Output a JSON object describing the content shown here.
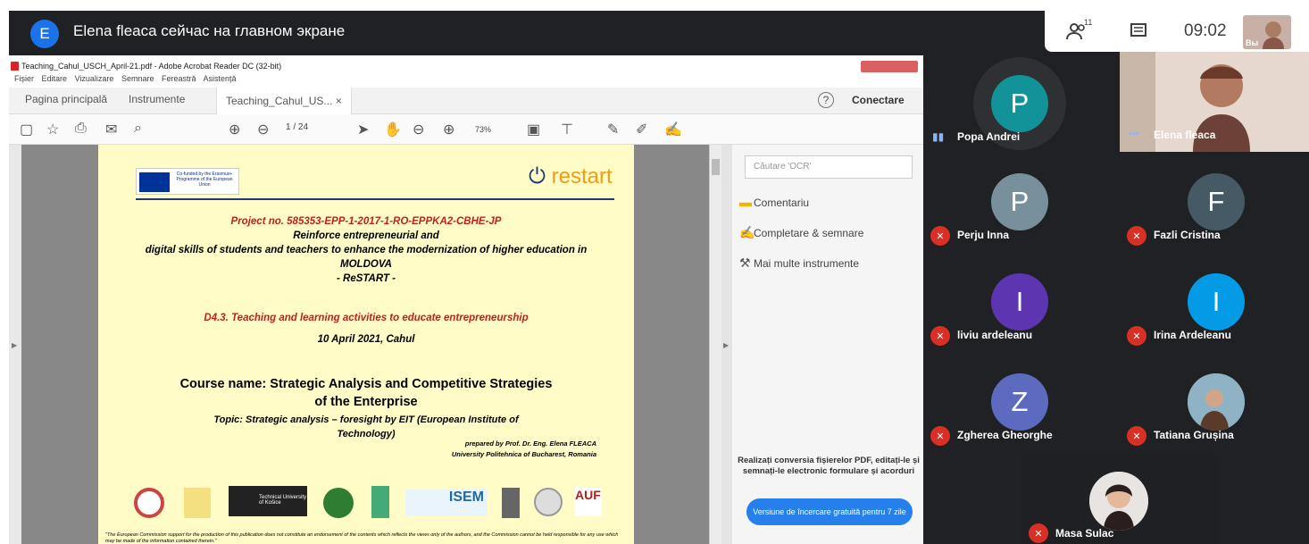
{
  "meet": {
    "presenter_initial": "E",
    "presenter_text": "Elena fleaca сейчас на главном экране",
    "participant_count": "11",
    "time": "09:02",
    "self_label": "Вы"
  },
  "reader": {
    "title": "Teaching_Cahul_USCH_April-21.pdf - Adobe Acrobat Reader DC (32-bit)",
    "menu": [
      "Fișier",
      "Editare",
      "Vizualizare",
      "Semnare",
      "Fereastră",
      "Asistență"
    ],
    "tabs": {
      "home": "Pagina principală",
      "tools": "Instrumente",
      "doc": "Teaching_Cahul_US..."
    },
    "connect": "Conectare",
    "page_current": "1",
    "page_total": "/ 24",
    "zoom": "73%"
  },
  "doc": {
    "eu_text": "Co-funded by the Erasmus+ Programme of the European Union",
    "logo": "restart",
    "project": "Project no. 585353-EPP-1-2017-1-RO-EPPKA2-CBHE-JP",
    "line1": "Reinforce entrepreneurial and",
    "line2": "digital skills of students and teachers to enhance the modernization of higher education in",
    "line3": "MOLDOVA",
    "line4": "- ReSTART -",
    "deliverable": "D4.3. Teaching and learning activities to educate entrepreneurship",
    "date": "10 April 2021, Cahul",
    "course1": "Course name: Strategic Analysis and Competitive Strategies",
    "course2": "of the Enterprise",
    "topic1": "Topic: Strategic analysis – foresight by EIT (European Institute of",
    "topic2": "Technology)",
    "prepared": "prepared by Prof. Dr. Eng. Elena FLEACA",
    "university": "University Politehnica of Bucharest, Romania",
    "disclaimer": "\"The European Commission support for the production of this publication does not constitute an endorsement of the contents which reflects the views only of the authors, and the Commission cannot be held responsible for any use which may be made of the information contained therein.\"",
    "logo_tu": "Technical University of Košice",
    "logo_isem": "ISEM",
    "logo_auf": "AUF"
  },
  "pane": {
    "ocr_placeholder": "Căutare 'OCR'",
    "t1": "Comentariu",
    "t2": "Completare & semnare",
    "t3": "Mai multe instrumente",
    "promo": "Realizați conversia fișierelor PDF, editați-le și semnați-le electronic formulare și acorduri",
    "trial": "Versiune de încercare gratuită pentru 7 zile"
  },
  "participants": [
    {
      "name": "Popa Andrei",
      "initial": "P",
      "color": "#12939a"
    },
    {
      "name": "Elena fleaca",
      "initial": ""
    },
    {
      "name": "Perju Inna",
      "initial": "P",
      "color": "#78909c"
    },
    {
      "name": "Fazli Cristina",
      "initial": "F",
      "color": "#455a64"
    },
    {
      "name": "liviu ardeleanu",
      "initial": "I",
      "color": "#5e35b1"
    },
    {
      "name": "Irina Ardeleanu",
      "initial": "I",
      "color": "#039be5"
    },
    {
      "name": "Zgherea Gheorghe",
      "initial": "Z",
      "color": "#5c6bc0"
    },
    {
      "name": "Tatiana Grușina",
      "initial": ""
    },
    {
      "name": "Masa Sulac",
      "initial": ""
    }
  ],
  "colors": {
    "meet_bg": "#202124",
    "page_bg": "#fffcc7",
    "project_red": "#c0201f",
    "mic_red": "#d93025"
  }
}
